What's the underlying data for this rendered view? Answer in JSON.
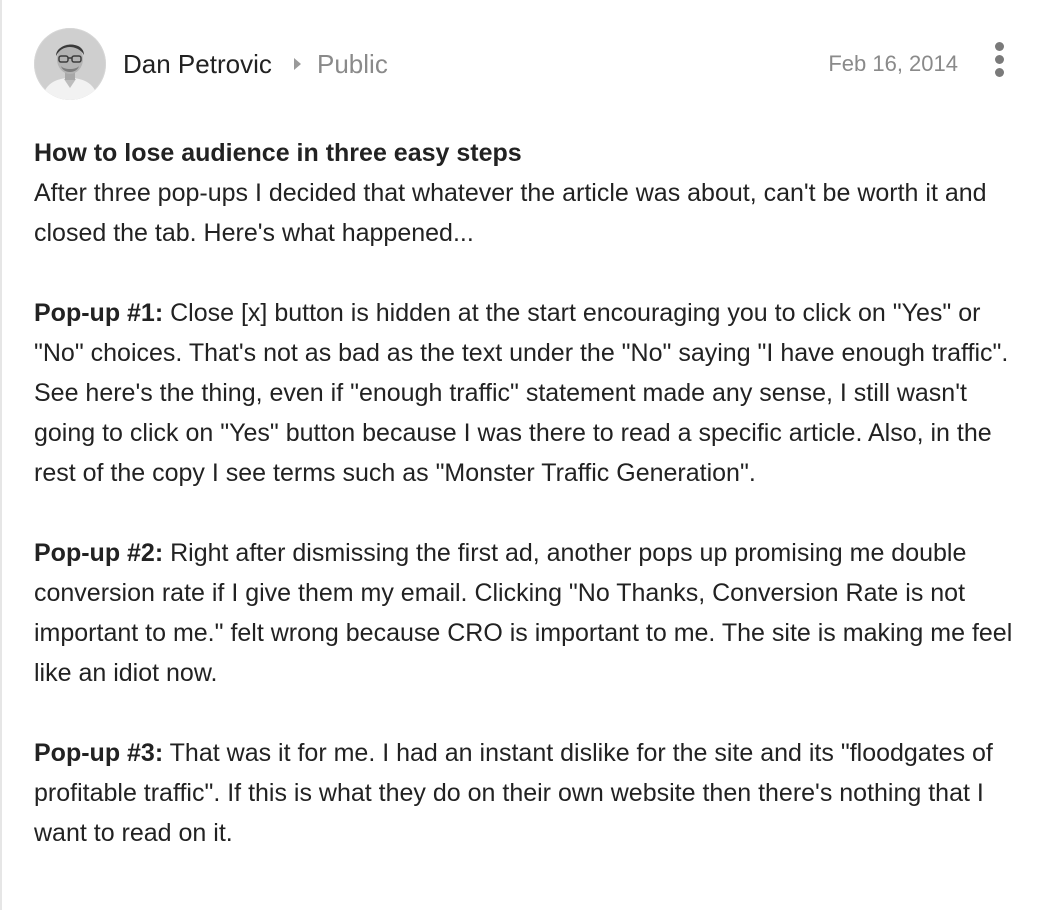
{
  "post": {
    "author": "Dan Petrovic",
    "visibility": "Public",
    "date": "Feb 16, 2014",
    "icons": {
      "avatar": "author-avatar-photo",
      "caret": "caret-right-icon",
      "more": "more-vertical-icon"
    },
    "title": "How to lose audience in three easy steps",
    "intro": "After three pop-ups I decided that whatever the article was about, can't be worth it and closed the tab. Here's what happened...",
    "popups": [
      {
        "label": "Pop-up #1:",
        "text": " Close [x] button is hidden at the start encouraging you to click on \"Yes\" or \"No\" choices. That's not as bad as the text under the \"No\" saying \"I have enough traffic\". See here's the thing, even if \"enough traffic\" statement made any sense, I still wasn't going to click on \"Yes\" button because I was there to read a specific article. Also, in the rest of the copy I see terms such as \"Monster Traffic Generation\"."
      },
      {
        "label": "Pop-up #2:",
        "text": " Right after dismissing the first ad, another pops up promising me double conversion rate if I give them my email. Clicking \"No Thanks, Conversion Rate is not important to me.\" felt wrong because CRO is important to me. The site is making me feel like an idiot now."
      },
      {
        "label": "Pop-up #3:",
        "text": " That was it for me. I had an instant dislike for the site and its \"floodgates of profitable traffic\". If this is what they do on their own website then there's nothing that I want to read on it."
      }
    ]
  }
}
